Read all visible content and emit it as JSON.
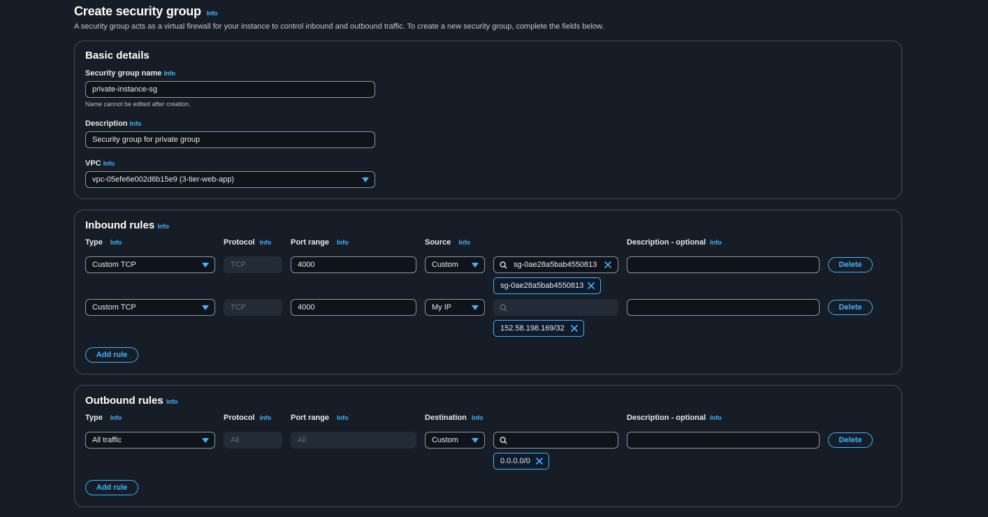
{
  "page": {
    "title": "Create security group",
    "info": "Info",
    "description": "A security group acts as a virtual firewall for your instance to control inbound and outbound traffic. To create a new security group, complete the fields below."
  },
  "basic": {
    "title": "Basic details",
    "name_label": "Security group name",
    "name_value": "private-instance-sg",
    "name_hint": "Name cannot be edited after creation.",
    "desc_label": "Description",
    "desc_value": "Security group for private group",
    "vpc_label": "VPC",
    "vpc_value": "vpc-05efe6e002d6b15e9 (3-tier-web-app)"
  },
  "inbound": {
    "title": "Inbound rules",
    "columns": {
      "type": "Type",
      "protocol": "Protocol",
      "port_range": "Port range",
      "source": "Source",
      "description": "Description - optional"
    },
    "rows": [
      {
        "type": "Custom TCP",
        "protocol": "TCP",
        "port_range": "4000",
        "source": "Custom",
        "search_value": "sg-0ae28a5bab4550813",
        "token": "sg-0ae28a5bab4550813",
        "description": "",
        "delete_label": "Delete"
      },
      {
        "type": "Custom TCP",
        "protocol": "TCP",
        "port_range": "4000",
        "source": "My IP",
        "search_value": "",
        "token": "152.58.198.169/32",
        "description": "",
        "delete_label": "Delete"
      }
    ],
    "add_rule_label": "Add rule"
  },
  "outbound": {
    "title": "Outbound rules",
    "columns": {
      "type": "Type",
      "protocol": "Protocol",
      "port_range": "Port range",
      "destination": "Destination",
      "description": "Description - optional"
    },
    "rows": [
      {
        "type": "All traffic",
        "protocol": "All",
        "port_range": "All",
        "destination": "Custom",
        "search_value": "",
        "token": "0.0.0.0/0",
        "description": "",
        "delete_label": "Delete"
      }
    ],
    "add_rule_label": "Add rule"
  },
  "colors": {
    "background": "#161d26",
    "accent": "#42b4ff",
    "border": "#414d5c",
    "input_bg": "#0f141a"
  }
}
